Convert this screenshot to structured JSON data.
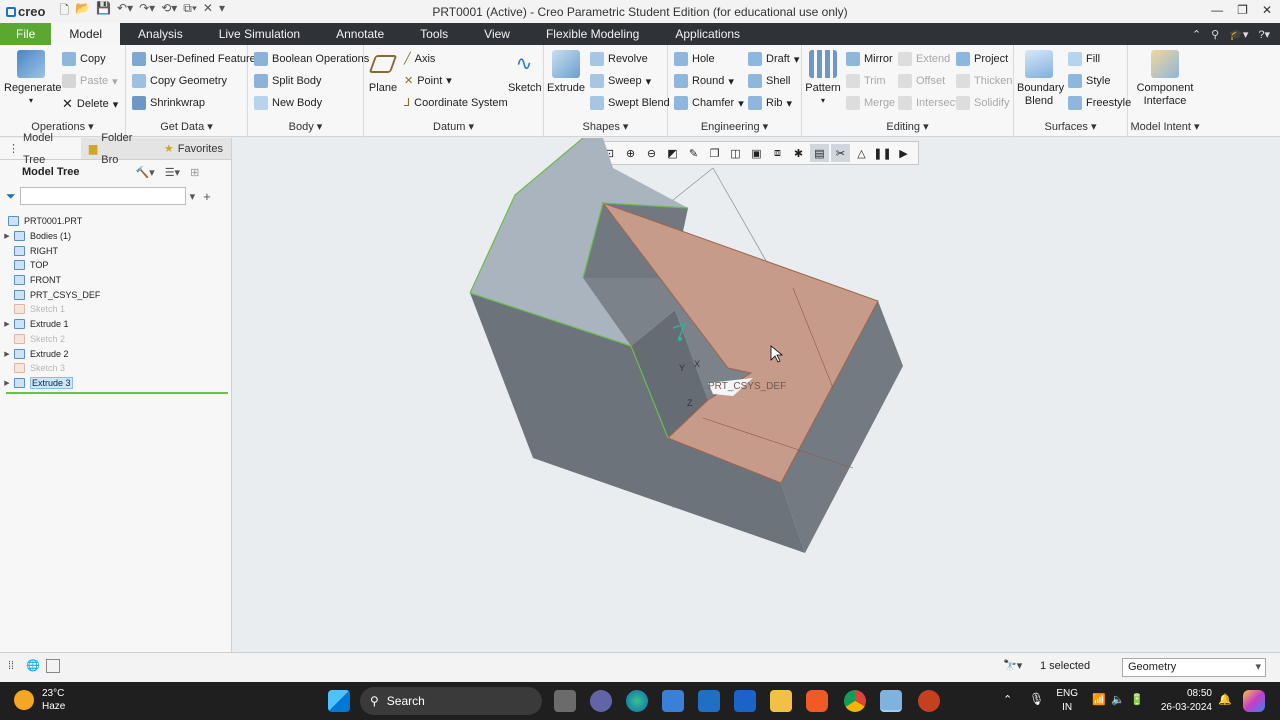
{
  "app": {
    "logo_text": "creo",
    "window_title": "PRT0001 (Active) - Creo Parametric Student Edition (for educational use only)"
  },
  "menu": {
    "items": [
      "File",
      "Model",
      "Analysis",
      "Live Simulation",
      "Annotate",
      "Tools",
      "View",
      "Flexible Modeling",
      "Applications"
    ],
    "active": "Model"
  },
  "ribbon": {
    "operations": {
      "label": "Operations",
      "regenerate": "Regenerate",
      "copy": "Copy",
      "paste": "Paste",
      "delete": "Delete"
    },
    "get_data": {
      "label": "Get Data",
      "udf": "User-Defined Feature",
      "copy_geometry": "Copy Geometry",
      "shrinkwrap": "Shrinkwrap"
    },
    "body": {
      "label": "Body",
      "boolean": "Boolean Operations",
      "split": "Split Body",
      "new": "New Body"
    },
    "datum": {
      "label": "Datum",
      "plane": "Plane",
      "axis": "Axis",
      "point": "Point",
      "csys": "Coordinate System",
      "sketch": "Sketch"
    },
    "shapes": {
      "label": "Shapes",
      "extrude": "Extrude",
      "revolve": "Revolve",
      "sweep": "Sweep",
      "swept_blend": "Swept Blend"
    },
    "engineering": {
      "label": "Engineering",
      "hole": "Hole",
      "round": "Round",
      "chamfer": "Chamfer",
      "draft": "Draft",
      "shell": "Shell",
      "rib": "Rib"
    },
    "editing": {
      "label": "Editing",
      "pattern": "Pattern",
      "mirror": "Mirror",
      "trim": "Trim",
      "merge": "Merge",
      "extend": "Extend",
      "offset": "Offset",
      "intersect": "Intersect",
      "project": "Project",
      "thicken": "Thicken",
      "solidify": "Solidify"
    },
    "surfaces": {
      "label": "Surfaces",
      "boundary_blend": "Boundary Blend",
      "fill": "Fill",
      "style": "Style",
      "freestyle": "Freestyle"
    },
    "model_intent": {
      "label": "Model Intent",
      "component_interface": "Component Interface"
    }
  },
  "panel": {
    "tabs": [
      "Model Tree",
      "Folder Bro",
      "Favorites"
    ],
    "title": "Model Tree",
    "tree": [
      {
        "label": "PRT0001.PRT",
        "arrow": "",
        "dim": false
      },
      {
        "label": "Bodies (1)",
        "arrow": "▶",
        "dim": false
      },
      {
        "label": "RIGHT",
        "arrow": "",
        "dim": false
      },
      {
        "label": "TOP",
        "arrow": "",
        "dim": false
      },
      {
        "label": "FRONT",
        "arrow": "",
        "dim": false
      },
      {
        "label": "PRT_CSYS_DEF",
        "arrow": "",
        "dim": false
      },
      {
        "label": "Sketch 1",
        "arrow": "",
        "dim": true
      },
      {
        "label": "Extrude 1",
        "arrow": "▶",
        "dim": false
      },
      {
        "label": "Sketch 2",
        "arrow": "",
        "dim": true
      },
      {
        "label": "Extrude 2",
        "arrow": "▶",
        "dim": false
      },
      {
        "label": "Sketch 3",
        "arrow": "",
        "dim": true
      },
      {
        "label": "Extrude 3",
        "arrow": "▶",
        "dim": false
      }
    ]
  },
  "viewport": {
    "csys_label": "PRT_CSYS_DEF",
    "axis_y": "Y",
    "axis_x": "X",
    "axis_z": "Z"
  },
  "status": {
    "selected": "1 selected",
    "filter": "Geometry"
  },
  "taskbar": {
    "temp": "23°C",
    "weather": "Haze",
    "search": "Search",
    "lang1": "ENG",
    "lang2": "IN",
    "time": "08:50",
    "date": "26-03-2024"
  }
}
